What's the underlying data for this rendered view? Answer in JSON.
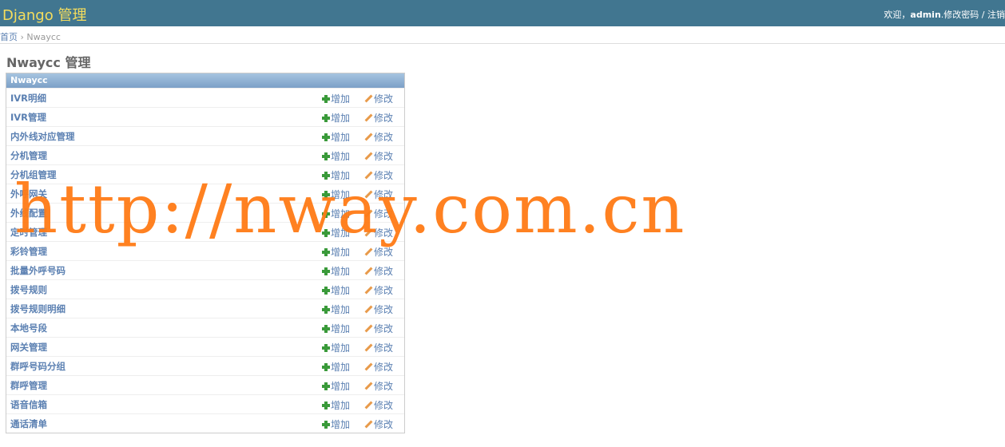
{
  "header": {
    "brand": "Django 管理",
    "welcome": "欢迎，",
    "username": "admin",
    "separator": ".",
    "change_password": "修改密码",
    "slash": " / ",
    "logout": "注销"
  },
  "breadcrumb": {
    "home": "首页",
    "sep": " › ",
    "current": "Nwaycc"
  },
  "page_title": "Nwaycc 管理",
  "module": {
    "caption": "Nwaycc",
    "add_label": "增加",
    "change_label": "修改",
    "models": [
      "IVR明细",
      "IVR管理",
      "内外线对应管理",
      "分机管理",
      "分机组管理",
      "外呼网关",
      "外线配置",
      "定时管理",
      "彩铃管理",
      "批量外呼号码",
      "拨号规则",
      "拨号规则明细",
      "本地号段",
      "网关管理",
      "群呼号码分组",
      "群呼管理",
      "语音信箱",
      "通话清单"
    ]
  },
  "watermark": "http://nway.com.cn",
  "colors": {
    "header_bg": "#417690",
    "brand": "#f5dd5d",
    "link": "#5b80b2",
    "caption_bg": "#7ca0c7",
    "watermark": "#ff7b16"
  }
}
